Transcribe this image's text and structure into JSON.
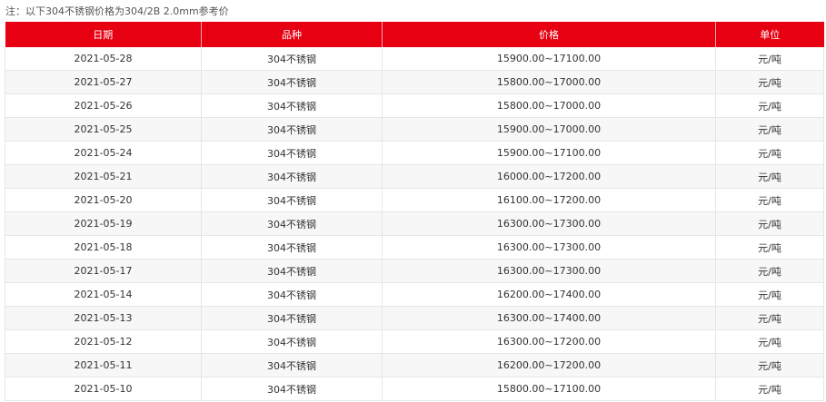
{
  "note": "注：以下304不锈钢价格为304/2B 2.0mm参考价",
  "colors": {
    "header_bg": "#e60012",
    "header_text": "#ffffff",
    "row_alt": "#f7f7f7"
  },
  "table": {
    "headers": [
      "日期",
      "品种",
      "价格",
      "单位"
    ],
    "rows": [
      [
        "2021-05-28",
        "304不锈钢",
        "15900.00~17100.00",
        "元/吨"
      ],
      [
        "2021-05-27",
        "304不锈钢",
        "15800.00~17000.00",
        "元/吨"
      ],
      [
        "2021-05-26",
        "304不锈钢",
        "15800.00~17000.00",
        "元/吨"
      ],
      [
        "2021-05-25",
        "304不锈钢",
        "15900.00~17000.00",
        "元/吨"
      ],
      [
        "2021-05-24",
        "304不锈钢",
        "15900.00~17100.00",
        "元/吨"
      ],
      [
        "2021-05-21",
        "304不锈钢",
        "16000.00~17200.00",
        "元/吨"
      ],
      [
        "2021-05-20",
        "304不锈钢",
        "16100.00~17200.00",
        "元/吨"
      ],
      [
        "2021-05-19",
        "304不锈钢",
        "16300.00~17300.00",
        "元/吨"
      ],
      [
        "2021-05-18",
        "304不锈钢",
        "16300.00~17300.00",
        "元/吨"
      ],
      [
        "2021-05-17",
        "304不锈钢",
        "16300.00~17300.00",
        "元/吨"
      ],
      [
        "2021-05-14",
        "304不锈钢",
        "16200.00~17400.00",
        "元/吨"
      ],
      [
        "2021-05-13",
        "304不锈钢",
        "16300.00~17400.00",
        "元/吨"
      ],
      [
        "2021-05-12",
        "304不锈钢",
        "16300.00~17200.00",
        "元/吨"
      ],
      [
        "2021-05-11",
        "304不锈钢",
        "16200.00~17200.00",
        "元/吨"
      ],
      [
        "2021-05-10",
        "304不锈钢",
        "15800.00~17100.00",
        "元/吨"
      ]
    ]
  }
}
